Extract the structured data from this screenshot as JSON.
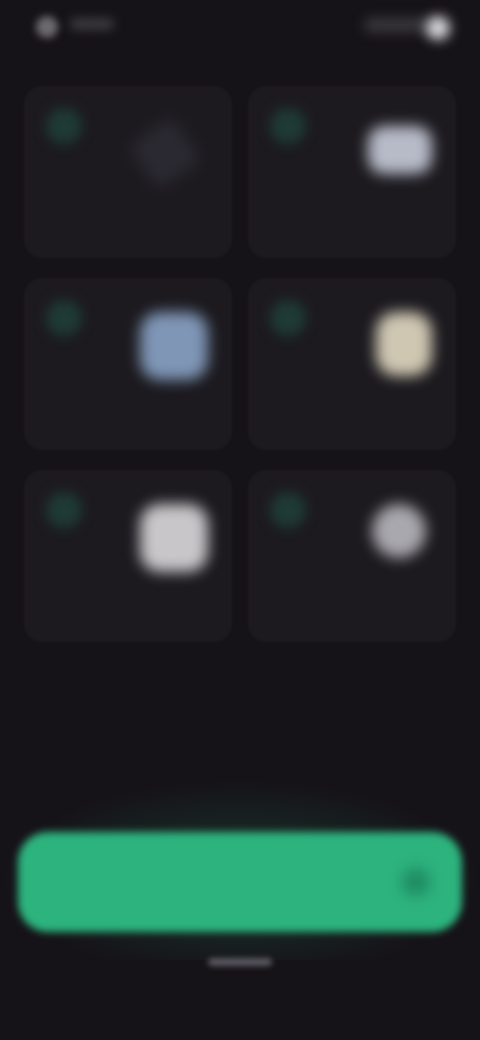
{
  "status_bar": {
    "icons": [
      "signal-icon",
      "wifi-icon",
      "battery-icon"
    ]
  },
  "cards": [
    {
      "label": "",
      "icon": "pencil-icon",
      "icon_color": "#2a2830"
    },
    {
      "label": "",
      "icon": "app-icon",
      "icon_color": "#b7bbc8"
    },
    {
      "label": "",
      "icon": "app-icon",
      "icon_color": "#7f96b6"
    },
    {
      "label": "",
      "icon": "app-icon",
      "icon_color": "#cfc7b2"
    },
    {
      "label": "",
      "icon": "app-icon",
      "icon_color": "#c8c6c8"
    },
    {
      "label": "",
      "icon": "app-icon",
      "icon_color": "#a9a8ae"
    }
  ],
  "section": {
    "title": "",
    "subtitle": ""
  },
  "cta": {
    "label": "",
    "icon": "arrow-right-icon"
  },
  "colors": {
    "background": "#161318",
    "card": "#1c1a1f",
    "accent": "#2db37e"
  }
}
